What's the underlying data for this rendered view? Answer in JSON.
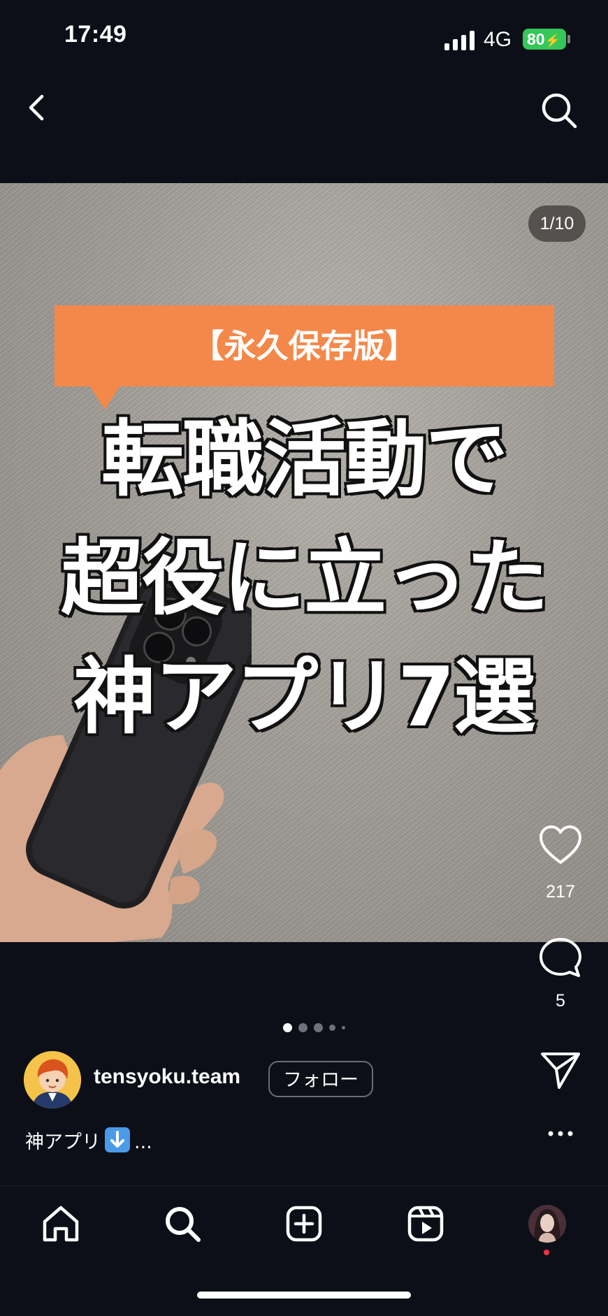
{
  "status_bar": {
    "time": "17:49",
    "network": "4G",
    "battery": "80"
  },
  "post": {
    "image_counter": "1/10",
    "banner": "【永久保存版】",
    "headline_lines": [
      "転職活動で",
      "超役に立った",
      "神アプリ7選"
    ],
    "carousel_dots": 5
  },
  "actions": {
    "likes": "217",
    "comments": "5"
  },
  "author": {
    "username": "tensyoku.team",
    "follow_label": "フォロー"
  },
  "caption": {
    "text_before": "神アプリ",
    "emoji": "down-arrow-emoji",
    "ellipsis": "..."
  },
  "colors": {
    "banner": "#f4884a",
    "battery": "#34c759",
    "notification": "#ff3040"
  },
  "tab_bar": {
    "items": [
      "home-icon",
      "search-icon",
      "create-icon",
      "reels-icon",
      "profile-avatar"
    ]
  }
}
